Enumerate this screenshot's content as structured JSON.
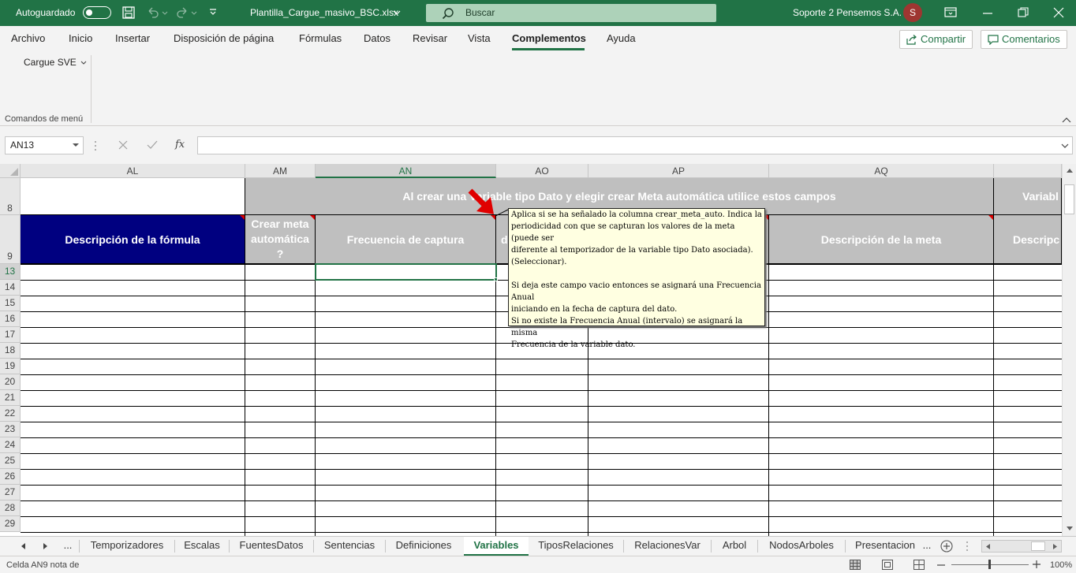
{
  "titlebar": {
    "autosave_label": "Autoguardado",
    "filename": "Plantilla_Cargue_masivo_BSC.xlsx",
    "search_placeholder": "Buscar",
    "account_name": "Soporte 2 Pensemos S.A.",
    "avatar_initial": "S"
  },
  "menu": {
    "items": [
      "Archivo",
      "Inicio",
      "Insertar",
      "Disposición de página",
      "Fórmulas",
      "Datos",
      "Revisar",
      "Vista",
      "Complementos",
      "Ayuda"
    ],
    "active": "Complementos",
    "share_label": "Compartir",
    "comments_label": "Comentarios"
  },
  "ribbon": {
    "addin_button": "Cargue SVE",
    "group_label": "Comandos de menú"
  },
  "formula_bar": {
    "name_box": "AN13",
    "fx_symbol": "fx",
    "formula": ""
  },
  "columns": [
    "AL",
    "AM",
    "AN",
    "AO",
    "AP",
    "AQ"
  ],
  "selected_column": "AN",
  "rows": [
    "8",
    "9",
    "13",
    "14",
    "15",
    "16",
    "17",
    "18",
    "19",
    "20",
    "21",
    "22",
    "23",
    "24",
    "25",
    "26",
    "27",
    "28",
    "29"
  ],
  "selected_row": "13",
  "sheet": {
    "row8_banner": "Al crear una Variable tipo Dato y elegir crear Meta automática utilice estos campos",
    "row8_next": "Variabl",
    "headers": {
      "AL": "Descripción de la fórmula",
      "AM_line1": "Crear meta",
      "AM_line2": "automática",
      "AM_line3": "?",
      "AN": "Frecuencia de captura",
      "AO_partial": "d",
      "AQ": "Descripción de la meta",
      "AR_partial": "Descripc"
    }
  },
  "note": {
    "lines": [
      "Aplica si se ha señalado la columna crear_meta_auto.  Indica la",
      "periodicidad con que se capturan los valores de la meta (puede ser",
      "diferente al temporizador de la variable tipo Dato asociada).",
      "(Seleccionar).",
      "",
      "Si deja este campo vacio entonces se asignará una Frecuencia Anual",
      "iniciando en la fecha de captura del dato.",
      "Si no existe la Frecuencia Anual (intervalo) se asignará la misma",
      "Frecuencia de la variable dato."
    ]
  },
  "tabs": {
    "ellipsis": "...",
    "items": [
      "Temporizadores",
      "Escalas",
      "FuentesDatos",
      "Sentencias",
      "Definiciones",
      "Variables",
      "TiposRelaciones",
      "RelacionesVar",
      "Arbol",
      "NodosArboles",
      "Presentacion"
    ],
    "active": "Variables",
    "more": "..."
  },
  "status": {
    "text": "Celda AN9 nota de",
    "zoom": "100%"
  },
  "colors": {
    "excel_green": "#217346",
    "navy_header": "#000080",
    "gray_header": "#bfbfbf",
    "note_bg": "#ffffe1"
  }
}
